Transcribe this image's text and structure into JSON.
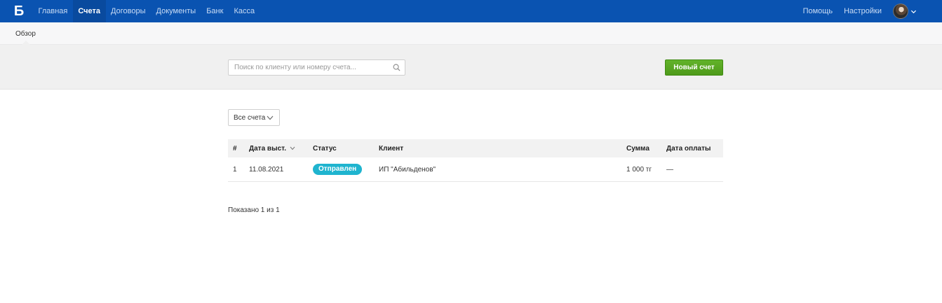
{
  "nav": {
    "logo": "Б",
    "items": [
      "Главная",
      "Счета",
      "Договоры",
      "Документы",
      "Банк",
      "Касса"
    ],
    "active_index": 1,
    "help": "Помощь",
    "settings": "Настройки"
  },
  "subnav": {
    "tab": "Обзор"
  },
  "toolbar": {
    "search_placeholder": "Поиск по клиенту или номеру счета...",
    "new_button": "Новый счет"
  },
  "filter": {
    "selected": "Все счета"
  },
  "table": {
    "headers": {
      "num": "#",
      "date": "Дата выст.",
      "status": "Статус",
      "client": "Клиент",
      "sum": "Сумма",
      "paid": "Дата оплаты"
    },
    "rows": [
      {
        "num": "1",
        "date": "11.08.2021",
        "status": "Отправлен",
        "client": "ИП \"Абильденов\"",
        "sum": "1 000 тг",
        "paid": "—"
      }
    ]
  },
  "footer": {
    "shown": "Показано 1 из 1"
  },
  "colors": {
    "topbar": "#0a53b1",
    "primary_button": "#52a01e",
    "status_badge": "#1fb4cf"
  }
}
